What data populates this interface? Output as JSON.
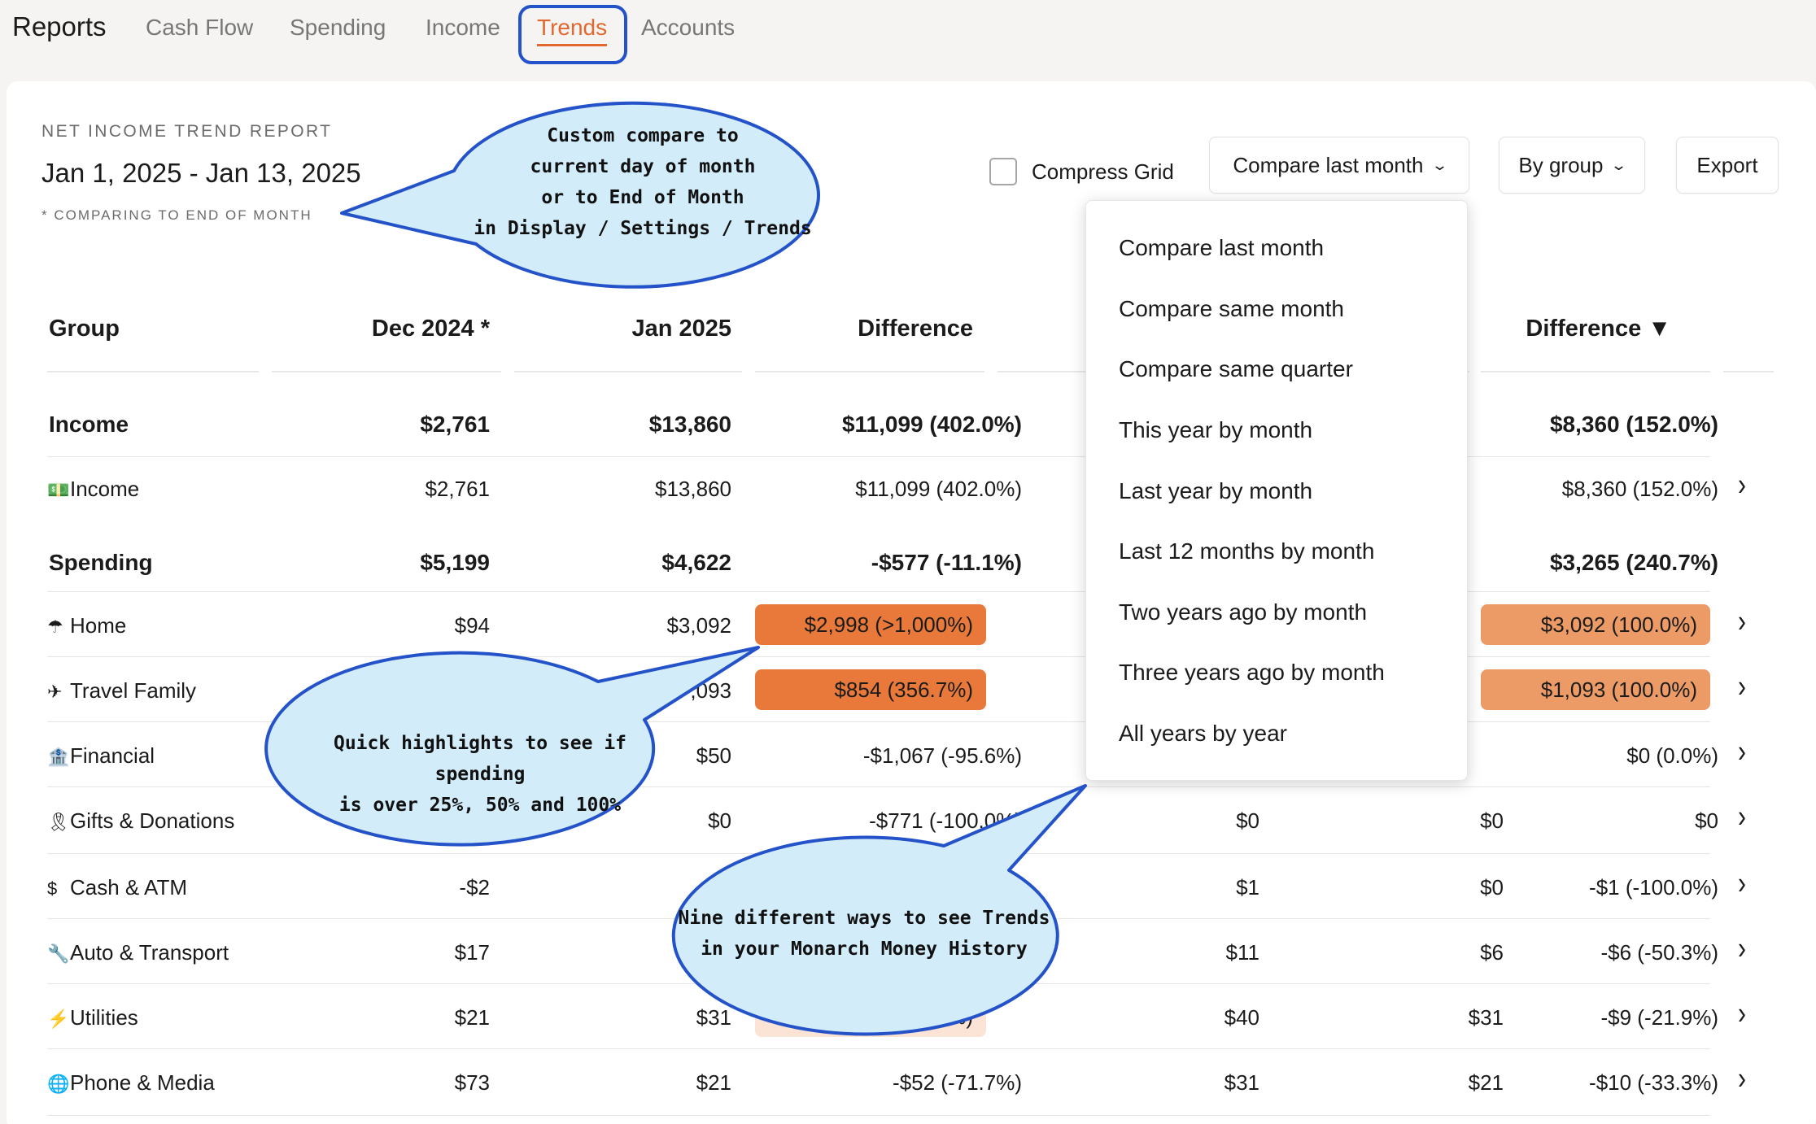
{
  "nav": {
    "title": "Reports",
    "tabs": [
      {
        "label": "Cash Flow"
      },
      {
        "label": "Spending"
      },
      {
        "label": "Income"
      },
      {
        "label": "Trends"
      },
      {
        "label": "Accounts"
      }
    ],
    "active_tab": "Trends"
  },
  "report": {
    "label": "NET INCOME TREND REPORT",
    "dates": "Jan 1, 2025 - Jan 13, 2025",
    "note": "* COMPARING TO END OF MONTH"
  },
  "controls": {
    "compress_label": "Compress Grid",
    "compare_label": "Compare last month",
    "group_label": "By group",
    "export_label": "Export"
  },
  "table": {
    "headers": {
      "group": "Group",
      "col1": "Dec 2024 *",
      "col2": "Jan 2025",
      "col3": "Difference",
      "col6": "Difference ▼"
    },
    "rows": [
      {
        "name": "Income",
        "type": "group",
        "c1": "$2,761",
        "c2": "$13,860",
        "c3": "$11,099 (402.0%)",
        "c4": "",
        "c5": "",
        "c6": "$8,360 (152.0%)"
      },
      {
        "name": "Income",
        "icon": "💵",
        "type": "item",
        "c1": "$2,761",
        "c2": "$13,860",
        "c3": "$11,099 (402.0%)",
        "c4": "",
        "c5": "",
        "c6": "$8,360 (152.0%)"
      },
      {
        "name": "Spending",
        "type": "group",
        "c1": "$5,199",
        "c2": "$4,622",
        "c3": "-$577 (-11.1%)",
        "c4": "",
        "c5": "",
        "c6": "$3,265 (240.7%)"
      },
      {
        "name": "Home",
        "icon": "☂",
        "type": "item",
        "c1": "$94",
        "c2": "$3,092",
        "c3": "$2,998 (>1,000%)",
        "c4": "",
        "c5": "",
        "c6": "$3,092 (100.0%)"
      },
      {
        "name": "Travel Family",
        "icon": "✈",
        "type": "item",
        "c1": "",
        "c2": ",093",
        "c3": "$854 (356.7%)",
        "c4": "",
        "c5": "",
        "c6": "$1,093 (100.0%)"
      },
      {
        "name": "Financial",
        "icon": "🏦",
        "type": "item",
        "c1": "",
        "c2": "$50",
        "c3": "-$1,067 (-95.6%)",
        "c4": "",
        "c5": "",
        "c6": "$0 (0.0%)"
      },
      {
        "name": "Gifts & Donations",
        "icon": "🎗",
        "type": "item",
        "c1": "",
        "c2": "$0",
        "c3": "-$771 (-100.0%)",
        "c4": "$0",
        "c5": "$0",
        "c6": "$0"
      },
      {
        "name": "Cash & ATM",
        "icon": "$",
        "type": "item",
        "c1": "-$2",
        "c2": "",
        "c3": "",
        "c4": "$1",
        "c5": "$0",
        "c6": "-$1 (-100.0%)"
      },
      {
        "name": "Auto & Transport",
        "icon": "🔧",
        "type": "item",
        "c1": "$17",
        "c2": "",
        "c3": "",
        "c4": "$11",
        "c5": "$6",
        "c6": "-$6 (-50.3%)"
      },
      {
        "name": "Utilities",
        "icon": "⚡",
        "type": "item",
        "c1": "$21",
        "c2": "$31",
        "c3": "..0%)",
        "c4": "$40",
        "c5": "$31",
        "c6": "-$9 (-21.9%)"
      },
      {
        "name": "Phone & Media",
        "icon": "🌐",
        "type": "item",
        "c1": "$73",
        "c2": "$21",
        "c3": "-$52 (-71.7%)",
        "c4": "$31",
        "c5": "$21",
        "c6": "-$10 (-33.3%)"
      }
    ]
  },
  "dropdown": {
    "options": [
      "Compare last month",
      "Compare same month",
      "Compare same quarter",
      "This year by month",
      "Last year by month",
      "Last 12 months by month",
      "Two years ago by month",
      "Three years ago by month",
      "All years by year"
    ]
  },
  "callouts": {
    "top": [
      "Custom compare to",
      "current day of month",
      "or to End of Month",
      "in Display / Settings / Trends"
    ],
    "middle": [
      "Quick highlights to see if spending",
      "is over 25%, 50% and 100%"
    ],
    "bottom": [
      "Nine different ways to see Trends",
      "in your Monarch Money History"
    ]
  },
  "colors": {
    "accent": "#e2682f",
    "highlight_strong": "#e8793a",
    "highlight_medium": "#ec9b67",
    "highlight_light": "#fbe3d5",
    "callout_fill": "#d3ecf9",
    "callout_stroke": "#2452c9"
  }
}
